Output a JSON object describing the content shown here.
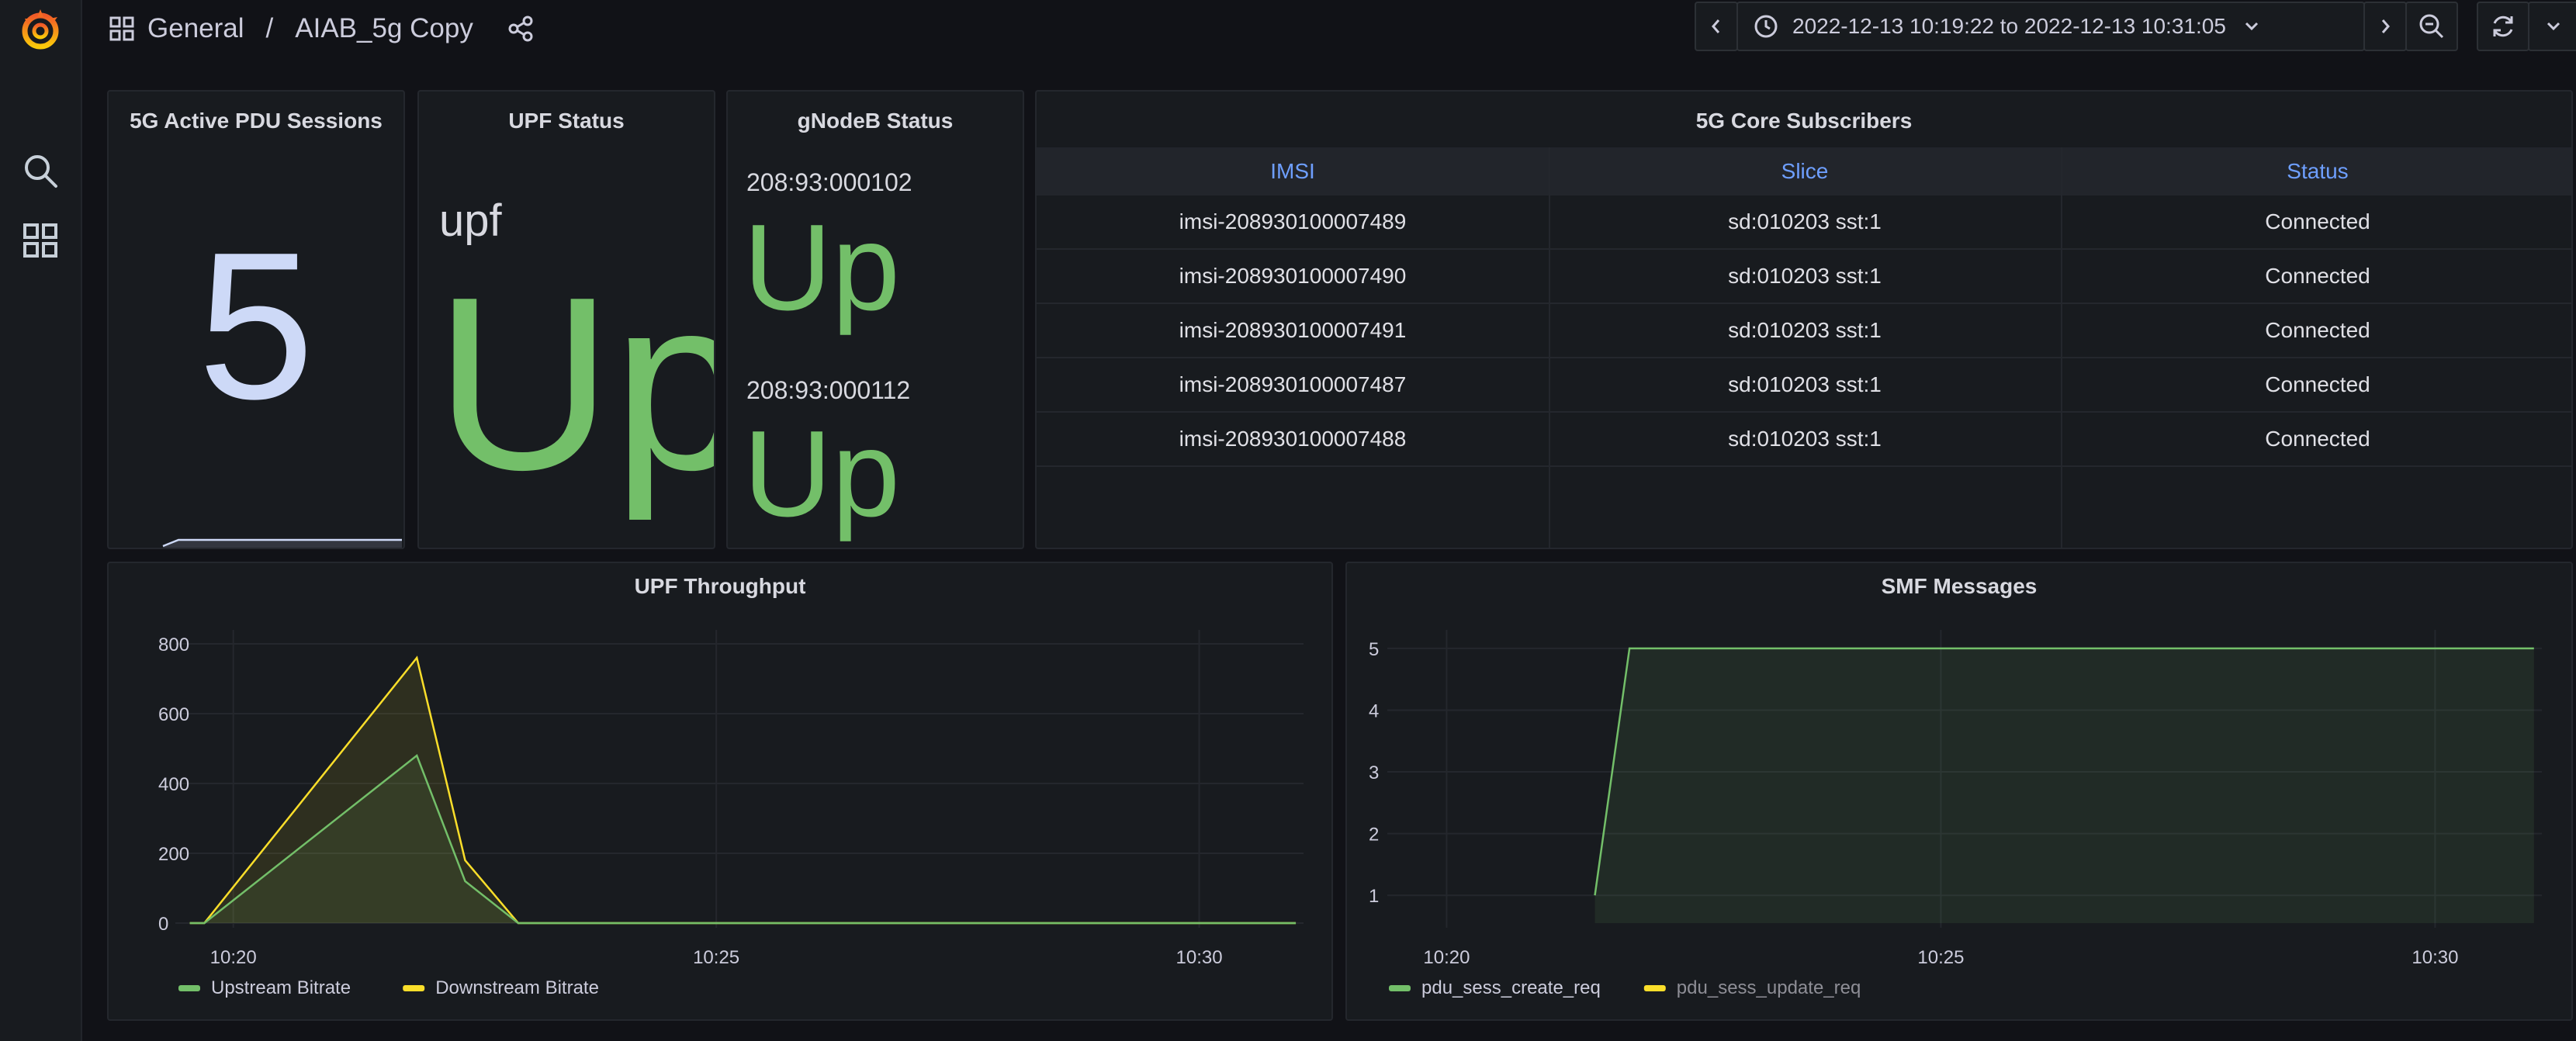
{
  "nav": {
    "breadcrumb_folder": "General",
    "breadcrumb_sep": "/",
    "dashboard_title": "AIAB_5g Copy",
    "time_range": "2022-12-13 10:19:22 to 2022-12-13 10:31:05"
  },
  "colors": {
    "green": "#73bf69",
    "yellow": "#fade2a",
    "stat_blue": "#cdd9f7",
    "header_blue": "#6e9fff"
  },
  "panels": {
    "pdu_sessions": {
      "title": "5G Active PDU Sessions",
      "value": "5"
    },
    "upf_status": {
      "title": "UPF Status",
      "name": "upf",
      "value": "Up"
    },
    "gnodeb_status": {
      "title": "gNodeB Status",
      "items": [
        {
          "name": "208:93:000102",
          "value": "Up"
        },
        {
          "name": "208:93:000112",
          "value": "Up"
        }
      ]
    },
    "subscribers": {
      "title": "5G Core Subscribers",
      "columns": [
        "IMSI",
        "Slice",
        "Status"
      ],
      "rows": [
        [
          "imsi-208930100007489",
          "sd:010203 sst:1",
          "Connected"
        ],
        [
          "imsi-208930100007490",
          "sd:010203 sst:1",
          "Connected"
        ],
        [
          "imsi-208930100007491",
          "sd:010203 sst:1",
          "Connected"
        ],
        [
          "imsi-208930100007487",
          "sd:010203 sst:1",
          "Connected"
        ],
        [
          "imsi-208930100007488",
          "sd:010203 sst:1",
          "Connected"
        ]
      ]
    },
    "upf_throughput": {
      "title": "UPF Throughput"
    },
    "smf_messages": {
      "title": "SMF Messages"
    }
  },
  "chart_data": [
    {
      "type": "area",
      "title": "UPF Throughput",
      "x_ticks": [
        "10:20",
        "10:25",
        "10:30"
      ],
      "y_ticks": [
        "0",
        "200",
        "400",
        "600",
        "800"
      ],
      "ylim": [
        0,
        840
      ],
      "xlim_minutes": [
        19.4,
        31.08
      ],
      "legend_position": "bottom-left",
      "grid": true,
      "series": [
        {
          "name": "Upstream Bitrate",
          "color": "#73bf69",
          "points": [
            [
              19.55,
              0
            ],
            [
              19.7,
              0
            ],
            [
              21.9,
              480
            ],
            [
              22.4,
              120
            ],
            [
              22.95,
              0
            ],
            [
              31.0,
              0
            ]
          ]
        },
        {
          "name": "Downstream Bitrate",
          "color": "#fade2a",
          "points": [
            [
              19.55,
              0
            ],
            [
              19.7,
              0
            ],
            [
              21.9,
              760
            ],
            [
              22.4,
              180
            ],
            [
              22.95,
              0
            ],
            [
              31.0,
              0
            ]
          ]
        }
      ]
    },
    {
      "type": "area",
      "title": "SMF Messages",
      "x_ticks": [
        "10:20",
        "10:25",
        "10:30"
      ],
      "y_ticks": [
        "1",
        "2",
        "3",
        "4",
        "5"
      ],
      "ylim": [
        0.55,
        5.3
      ],
      "xlim_minutes": [
        19.4,
        31.08
      ],
      "legend_position": "bottom-left",
      "grid": true,
      "series": [
        {
          "name": "pdu_sess_create_req",
          "color": "#73bf69",
          "points": [
            [
              21.5,
              1
            ],
            [
              21.85,
              5
            ],
            [
              31.0,
              5
            ]
          ]
        },
        {
          "name": "pdu_sess_update_req",
          "color": "#fade2a",
          "points": []
        }
      ]
    }
  ]
}
